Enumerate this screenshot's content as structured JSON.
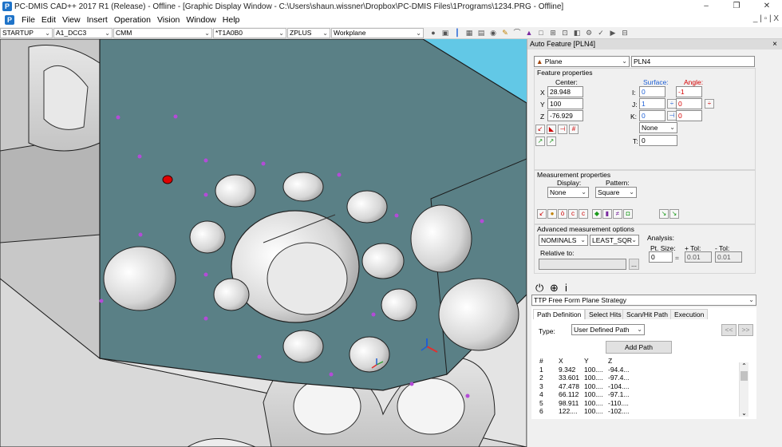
{
  "window": {
    "title": "PC-DMIS CAD++ 2017 R1 (Release) - Offline - [Graphic Display Window - C:\\Users\\shaun.wissner\\Dropbox\\PC-DMIS Files\\1Programs\\1234.PRG - Offline]",
    "app_icon": "P",
    "minimize": "–",
    "maximize": "❐",
    "close": "✕"
  },
  "menu": {
    "items": [
      "File",
      "Edit",
      "View",
      "Insert",
      "Operation",
      "Vision",
      "Window",
      "Help"
    ],
    "mdi_controls": "_ | ▫ | X"
  },
  "toolbar": {
    "combos": [
      "STARTUP",
      "A1_DCC3",
      "CMM",
      "*T1A0B0",
      "ZPLUS",
      "Workplane"
    ]
  },
  "panel": {
    "title": "Auto Feature [PLN4]",
    "close": "×",
    "feature_type": "Plane",
    "feature_name": "PLN4",
    "feature_props_label": "Feature properties",
    "center_label": "Center:",
    "surface_label": "Surface:",
    "angle_label": "Angle:",
    "x_label": "X",
    "y_label": "Y",
    "z_label": "Z",
    "center_x": "28.948",
    "center_y": "100",
    "center_z": "-76.929",
    "i_label": "I:",
    "j_label": "J:",
    "k_label": "K:",
    "t_label": "T:",
    "surface_i": "0",
    "surface_j": "1",
    "surface_k": "0",
    "angle_i": "-1",
    "angle_j": "0",
    "angle_k": "0",
    "orient": "None",
    "thickness": "0",
    "measurement_props_label": "Measurement properties",
    "display_label": "Display:",
    "pattern_label": "Pattern:",
    "display_value": "None",
    "pattern_value": "Square",
    "advanced_label": "Advanced measurement options",
    "nominals": "NOMINALS",
    "best_fit": "LEAST_SQR",
    "relative_to_label": "Relative to:",
    "relative_to_button": "...",
    "analysis_label": "Analysis:",
    "pt_size_label": "Pt. Size:",
    "plus_tol_label": "+ Tol:",
    "minus_tol_label": "- Tol:",
    "pt_size": "0",
    "plus_tol": "0.01",
    "minus_tol": "0.01",
    "strategy": "TTP Free Form Plane Strategy",
    "tabs": [
      "Path Definition",
      "Select Hits",
      "Scan/Hit Path",
      "Execution"
    ],
    "type_label": "Type:",
    "path_type": "User Defined Path",
    "prev_btn": "<<",
    "next_btn": ">>",
    "add_path_button": "Add Path",
    "table_headers": [
      "#",
      "X",
      "Y",
      "Z"
    ],
    "table_rows": [
      [
        "1",
        "9.342",
        "100....",
        "-94.4..."
      ],
      [
        "2",
        "33.601",
        "100....",
        "-97.4..."
      ],
      [
        "3",
        "47.478",
        "100....",
        "-104...."
      ],
      [
        "4",
        "66.112",
        "100....",
        "-97.1..."
      ],
      [
        "5",
        "98.911",
        "100....",
        "-110...."
      ],
      [
        "6",
        "122....",
        "100....",
        "-102...."
      ]
    ]
  }
}
